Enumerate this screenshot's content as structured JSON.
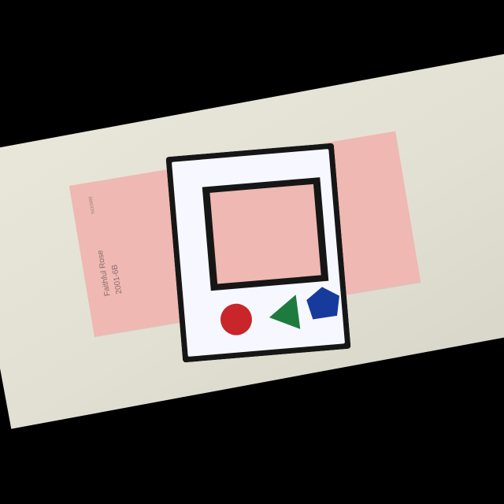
{
  "swatch": {
    "name": "Faithful Rose",
    "code": "2001-6B",
    "serial": "NO0988",
    "color": "#efb8b2"
  },
  "card": {
    "frame_color": "#161616",
    "face_color": "#f7f8ff",
    "window_color": "#efb8b2",
    "shapes": [
      {
        "name": "circle",
        "color": "#c8262a"
      },
      {
        "name": "triangle",
        "color": "#1d7b3e"
      },
      {
        "name": "pentagon",
        "color": "#163b9c"
      }
    ]
  },
  "background": {
    "sheet_color": "#e6e4d8",
    "outer_color": "#000000"
  }
}
